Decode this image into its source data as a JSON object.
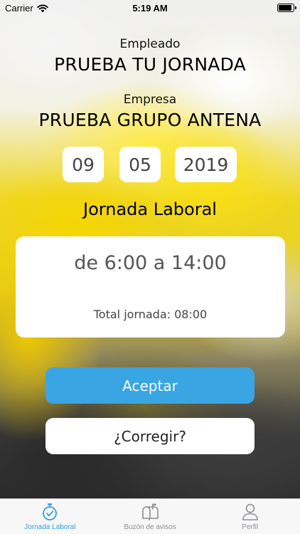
{
  "status_bar": {
    "carrier": "Carrier",
    "time": "5:19 AM"
  },
  "employee": {
    "label": "Empleado",
    "name": "PRUEBA TU JORNADA"
  },
  "company": {
    "label": "Empresa",
    "name": "PRUEBA GRUPO ANTENA"
  },
  "date": {
    "day": "09",
    "month": "05",
    "year": "2019"
  },
  "workday": {
    "title": "Jornada Laboral",
    "hours": "de 6:00 a 14:00",
    "total": "Total jornada: 08:00"
  },
  "actions": {
    "accept": "Aceptar",
    "correct": "¿Corregir?"
  },
  "tabs": [
    {
      "label": "Jornada Laboral",
      "icon": "stopwatch-check-icon",
      "active": true
    },
    {
      "label": "Buzón de avisos",
      "icon": "mailbox-icon",
      "active": false
    },
    {
      "label": "Perfil",
      "icon": "person-icon",
      "active": false
    }
  ],
  "colors": {
    "accent": "#3aa5e3",
    "tab_active": "#2f9de0",
    "tab_inactive": "#8e8e93"
  }
}
